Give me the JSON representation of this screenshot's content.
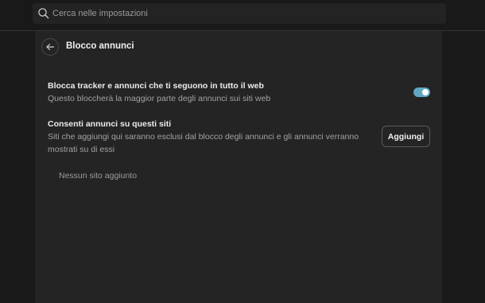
{
  "search": {
    "placeholder": "Cerca nelle impostazioni",
    "icon": "search-icon"
  },
  "header": {
    "back_icon": "arrow-left-icon",
    "title": "Blocco annunci"
  },
  "settings": {
    "tracker": {
      "title": "Blocca tracker e annunci che ti seguono in tutto il web",
      "description": "Questo bloccherà la maggior parte degli annunci sui siti web",
      "enabled": true
    },
    "allow_sites": {
      "title": "Consenti annunci su questi siti",
      "description": "Siti che aggiungi qui saranno esclusi dal blocco degli annunci e gli annunci verranno mostrati su di essi",
      "button_label": "Aggiungi",
      "empty_text": "Nessun sito aggiunto"
    }
  },
  "colors": {
    "background": "#191919",
    "panel": "#242424",
    "toggle_on": "#5fa8c2"
  }
}
